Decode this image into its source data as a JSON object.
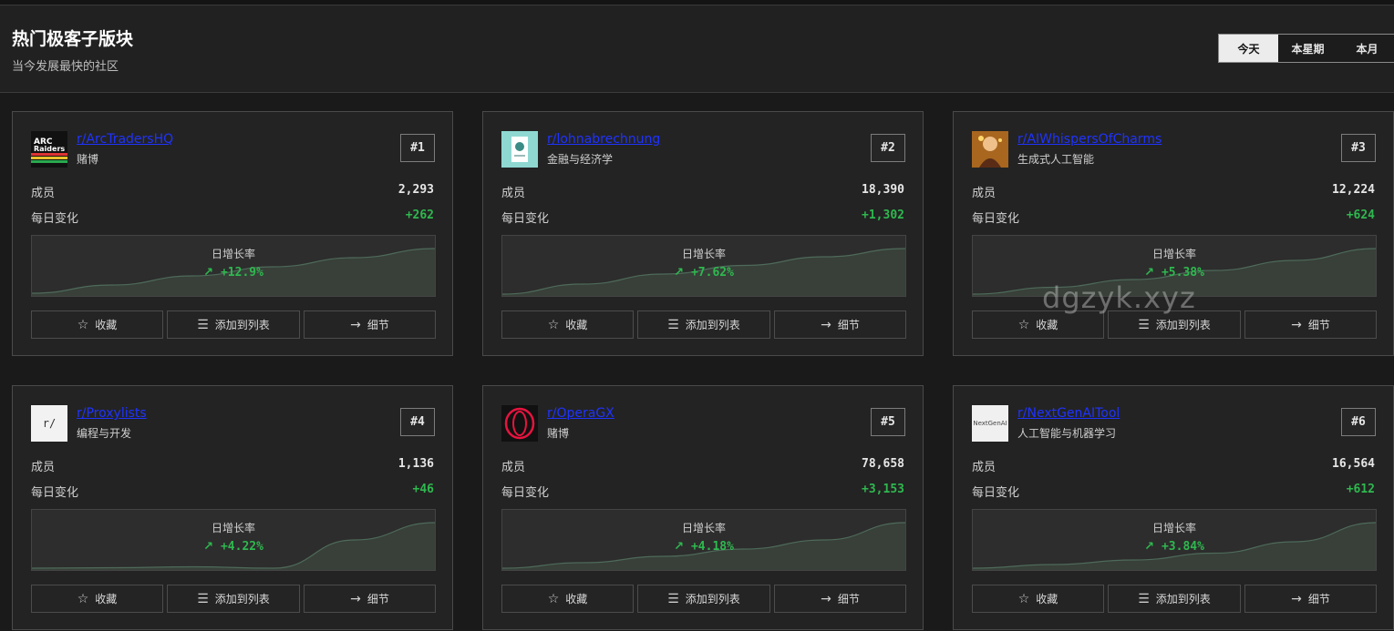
{
  "header": {
    "title": "热门极客子版块",
    "subtitle": "当今发展最快的社区",
    "tabs": [
      "今天",
      "本星期",
      "本月"
    ],
    "active_tab": "今天"
  },
  "labels": {
    "members": "成员",
    "daily_change": "每日变化",
    "growth_rate": "日增长率",
    "favorite": "收藏",
    "add_to_list": "添加到列表",
    "details": "细节"
  },
  "colors": {
    "link": "#1f33ff",
    "positive": "#2fb84f",
    "card_bg": "#232323",
    "page_bg": "#1a1a1a"
  },
  "cards": [
    {
      "name": "r/ArcTradersHQ",
      "category": "赌博",
      "rank": "#1",
      "members": "2,293",
      "daily_change": "+262",
      "growth": "+12.9%",
      "avatar": "arc-raiders-logo",
      "trend": [
        0.02,
        0.2,
        0.4,
        0.6,
        0.8,
        1.0
      ]
    },
    {
      "name": "r/lohnabrechnung",
      "category": "金融与经济学",
      "rank": "#2",
      "members": "18,390",
      "daily_change": "+1,302",
      "growth": "+7.62%",
      "avatar": "euro-document-icon",
      "trend": [
        0.0,
        0.22,
        0.44,
        0.63,
        0.82,
        1.0
      ]
    },
    {
      "name": "r/AIWhispersOfCharms",
      "category": "生成式人工智能",
      "rank": "#3",
      "members": "12,224",
      "daily_change": "+624",
      "growth": "+5.38%",
      "avatar": "ai-portrait",
      "trend": [
        0.0,
        0.15,
        0.32,
        0.52,
        0.74,
        1.0
      ]
    },
    {
      "name": "r/Proxylists",
      "category": "编程与开发",
      "rank": "#4",
      "members": "1,136",
      "daily_change": "+46",
      "growth": "+4.22%",
      "avatar": "r-slash-placeholder",
      "avatar_text": "r/",
      "trend": [
        0.0,
        0.01,
        0.03,
        0.0,
        0.62,
        1.0
      ]
    },
    {
      "name": "r/OperaGX",
      "category": "赌博",
      "rank": "#5",
      "members": "78,658",
      "daily_change": "+3,153",
      "growth": "+4.18%",
      "avatar": "opera-gx-logo",
      "trend": [
        0.0,
        0.12,
        0.26,
        0.42,
        0.62,
        1.0
      ]
    },
    {
      "name": "r/NextGenAITool",
      "category": "人工智能与机器学习",
      "rank": "#6",
      "members": "16,564",
      "daily_change": "+612",
      "growth": "+3.84%",
      "avatar": "nextgenai-logo",
      "avatar_text": "NextGenAI",
      "trend": [
        0.0,
        0.08,
        0.18,
        0.33,
        0.58,
        1.0
      ]
    }
  ],
  "watermark": "dgzyk.xyz"
}
